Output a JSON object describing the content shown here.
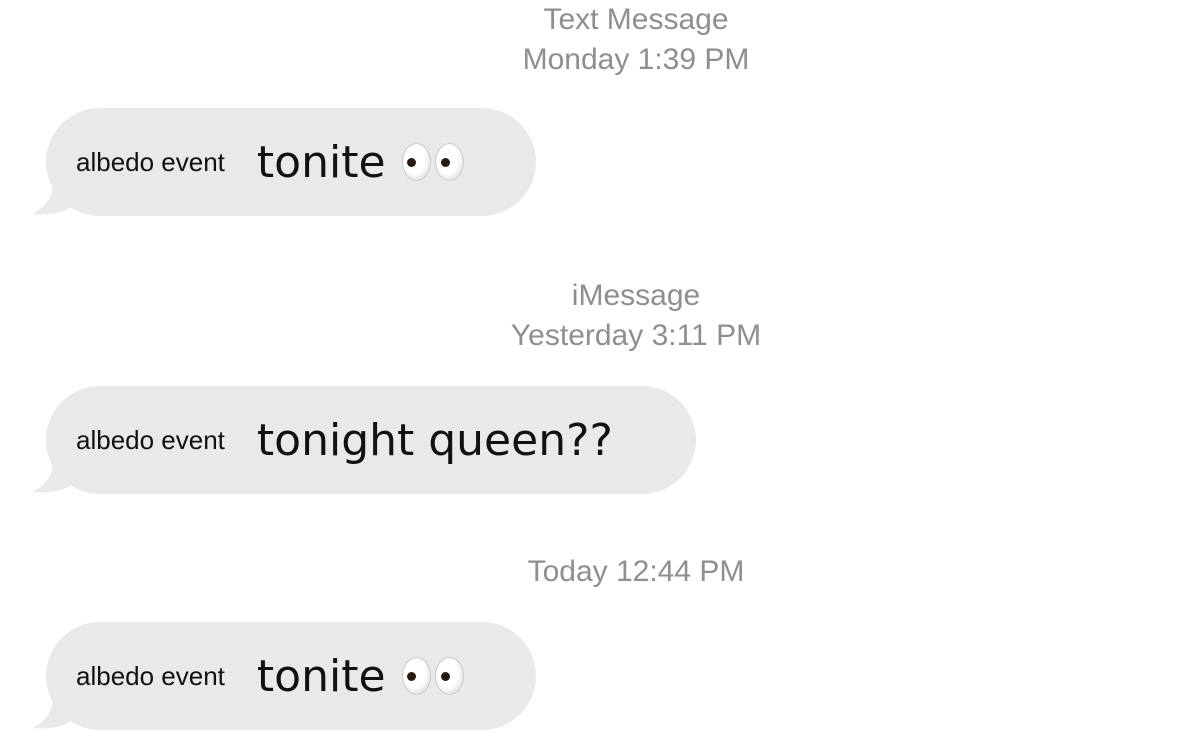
{
  "timestamps": [
    {
      "service": "Text Message",
      "time": "Monday 1:39 PM"
    },
    {
      "service": "iMessage",
      "time": "Yesterday 3:11 PM"
    },
    {
      "service": "",
      "time": "Today 12:44 PM"
    }
  ],
  "messages": [
    {
      "sender": "albedo event",
      "text": "tonite",
      "emoji": "eyes-emoji"
    },
    {
      "sender": "albedo event",
      "text": "tonight queen??",
      "emoji": ""
    },
    {
      "sender": "albedo event",
      "text": "tonite",
      "emoji": "eyes-emoji"
    }
  ],
  "colors": {
    "incoming_bubble": "#e9e9eb",
    "timestamp_text": "#8e8e93",
    "message_text": "#111111",
    "background": "#ffffff"
  }
}
